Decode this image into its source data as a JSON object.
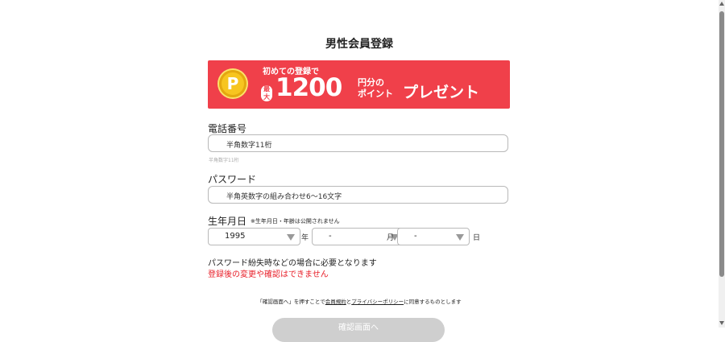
{
  "page": {
    "title": "男性会員登録"
  },
  "banner": {
    "coin_letter": "P",
    "first_text": "初めての登録で",
    "max_label": "最大",
    "amount": "1200",
    "unit_line1": "円分の",
    "unit_line2": "ポイント",
    "present": "プレゼント",
    "colors": {
      "background": "#f0404a",
      "coin": "#f7c520"
    }
  },
  "phone": {
    "label": "電話番号",
    "placeholder": "半角数字11桁",
    "hint": "半角数字11桁"
  },
  "password": {
    "label": "パスワード",
    "placeholder": "半角英数字の組み合わせ6～16文字"
  },
  "birthdate": {
    "label": "生年月日",
    "note": "※生年月日・年齢は公開されません",
    "year_value": "1995",
    "year_suffix": "年",
    "month_value": "-",
    "month_suffix": "月",
    "day_value": "-",
    "day_suffix": "日"
  },
  "info": {
    "text": "パスワード紛失時などの場合に必要となります",
    "warning": "登録後の変更や確認はできません",
    "warning_color": "#e8202a"
  },
  "agreement": {
    "prefix": "「確認画面へ」を押すことで",
    "terms_link": "会員規約",
    "and": "と",
    "privacy_link": "プライバシーポリシー",
    "suffix": "に同意するものとします"
  },
  "submit": {
    "label": "確認画面へ"
  }
}
